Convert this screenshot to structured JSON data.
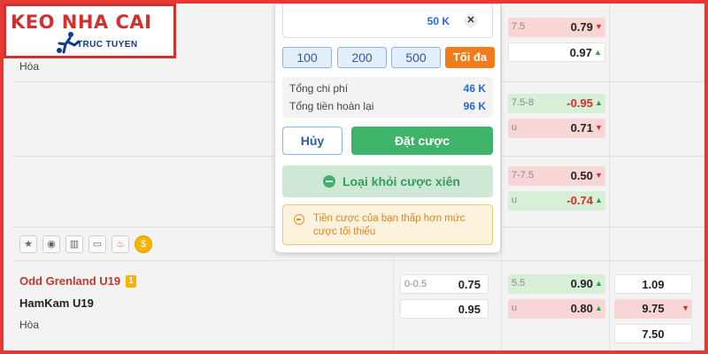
{
  "logo": {
    "title": "KEO NHA CAI",
    "subtitle": "TRUC TUYEN"
  },
  "match_above": {
    "draw_label": "Hòa"
  },
  "rows_above": [
    {
      "ou_top": {
        "handicap": "7.5",
        "value": "0.79",
        "trend": "down"
      },
      "ou_bottom": {
        "handicap": "",
        "value": "0.97",
        "trend": "up"
      }
    },
    {
      "ou_top": {
        "handicap": "7.5-8",
        "value": "-0.95",
        "trend": "up"
      },
      "ou_bottom": {
        "handicap": "u",
        "value": "0.71",
        "trend": "down"
      }
    },
    {
      "ou_top": {
        "handicap": "7-7.5",
        "value": "0.50",
        "trend": "down"
      },
      "ou_bottom": {
        "handicap": "u",
        "value": "-0.74",
        "trend": "up"
      }
    }
  ],
  "toolbar_icons": [
    "star-icon",
    "eye-icon",
    "stats-icon",
    "field-icon",
    "fire-icon",
    "coin-icon"
  ],
  "match": {
    "home": "Odd Grenland U19",
    "home_badge": "1",
    "away": "HamKam U19",
    "draw_label": "Hòa",
    "handicap": {
      "home": {
        "line": "0-0.5",
        "value": "0.75"
      },
      "away": {
        "line": "",
        "value": "0.95"
      }
    },
    "over_under": {
      "over": {
        "line": "5.5",
        "value": "0.90",
        "trend": "up"
      },
      "under": {
        "line": "u",
        "value": "0.80",
        "trend": "up"
      }
    },
    "one_x_two": {
      "home": "1.09",
      "away": "9.75",
      "draw": "7.50",
      "away_trend": "down"
    }
  },
  "bet_slip": {
    "amount": "50 K",
    "clear_icon": "close-icon",
    "quick_amounts": [
      "100",
      "200",
      "500"
    ],
    "max_label": "Tối đa",
    "summary": [
      {
        "label": "Tổng chi phí",
        "value": "46 K"
      },
      {
        "label": "Tổng tiền hoàn lại",
        "value": "96 K"
      }
    ],
    "cancel_label": "Hủy",
    "place_label": "Đặt cược",
    "remove_label": "Loại khỏi cược xiên",
    "warning": "Tiền cược của bạn thấp hơn mức cược tối thiểu"
  },
  "colors": {
    "frame": "#e53935",
    "accent_green": "#3fb36a",
    "accent_orange": "#f07d1a",
    "link_blue": "#2a6ac8"
  }
}
